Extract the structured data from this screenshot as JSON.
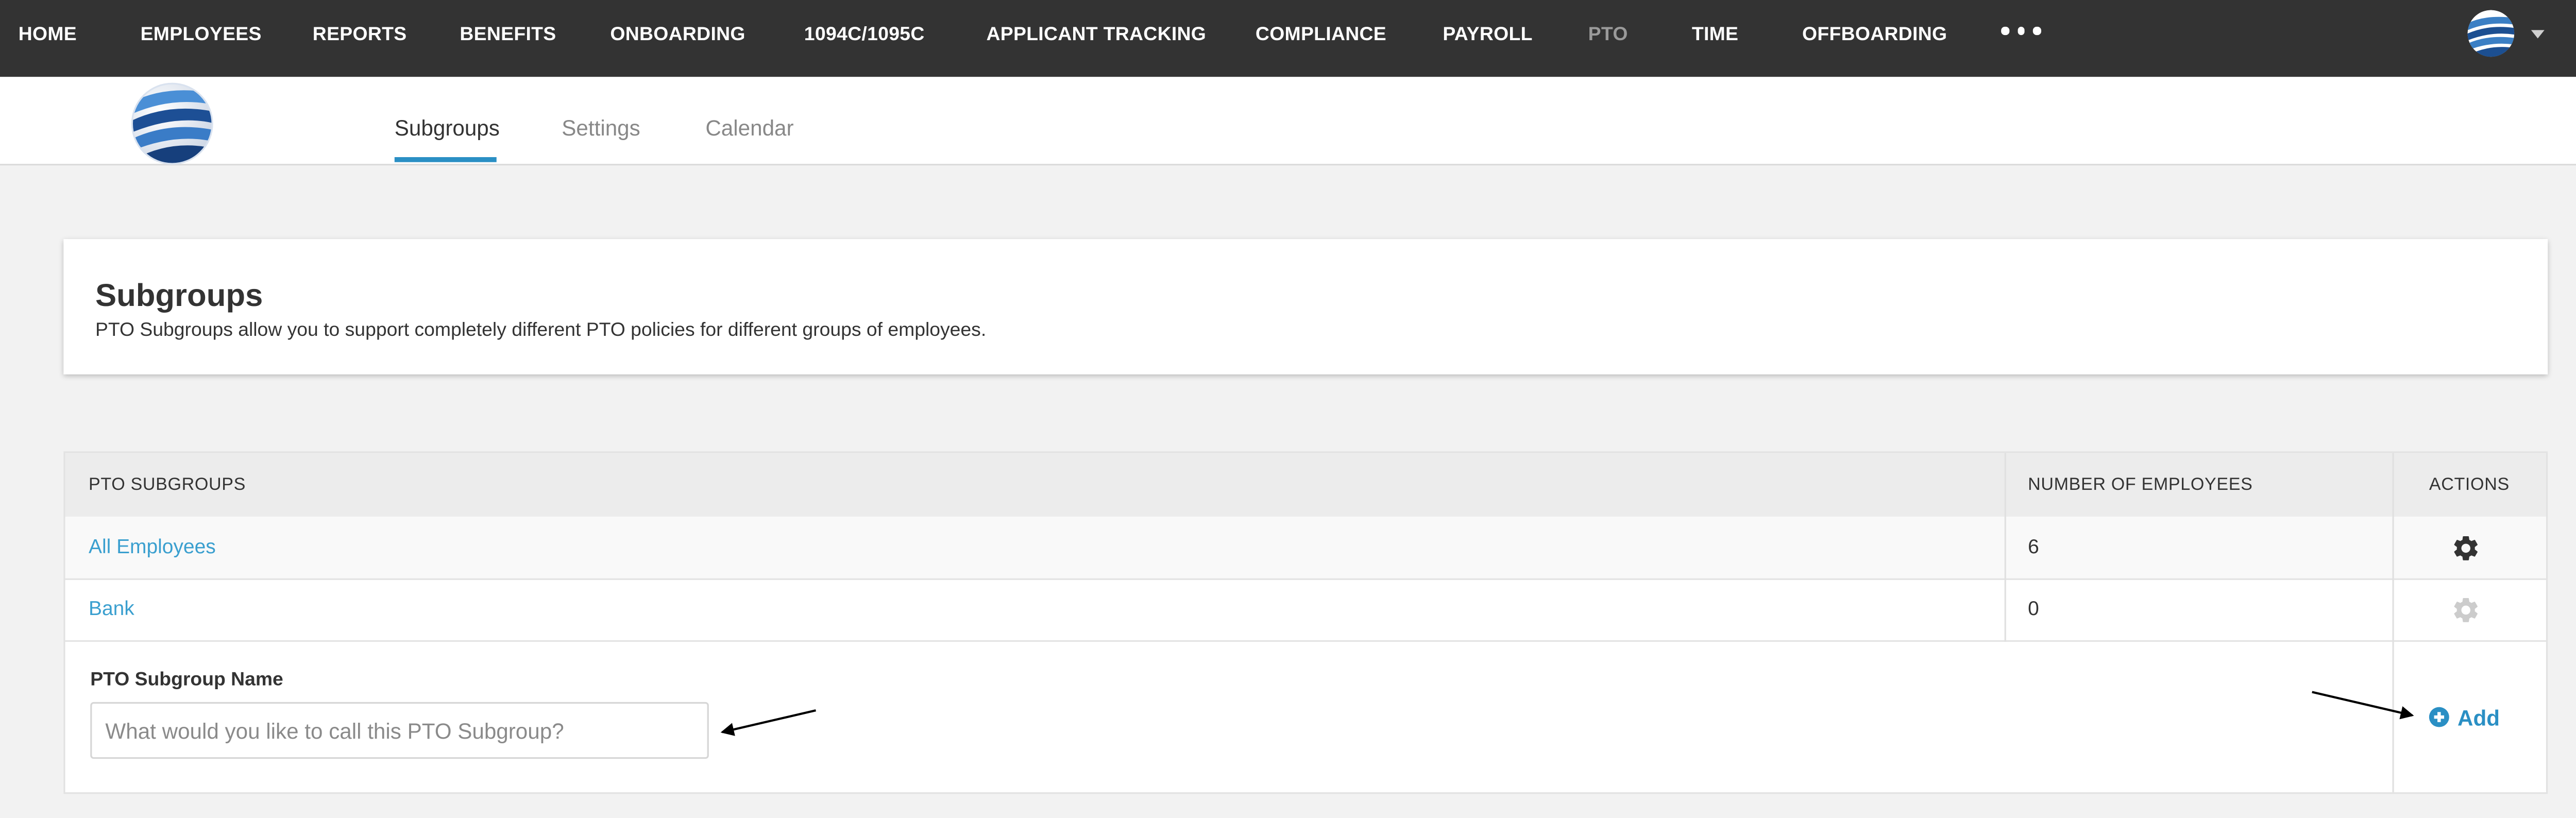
{
  "nav": {
    "items": [
      "HOME",
      "EMPLOYEES",
      "REPORTS",
      "BENEFITS",
      "ONBOARDING",
      "1094C/1095C",
      "APPLICANT TRACKING",
      "COMPLIANCE",
      "PAYROLL",
      "PTO",
      "TIME",
      "OFFBOARDING"
    ],
    "active": "PTO"
  },
  "tabs": [
    "Subgroups",
    "Settings",
    "Calendar"
  ],
  "card": {
    "title": "Subgroups",
    "description": "PTO Subgroups allow you to support completely different PTO policies for different groups of employees."
  },
  "table": {
    "headers": [
      "PTO SUBGROUPS",
      "NUMBER OF EMPLOYEES",
      "ACTIONS"
    ],
    "rows": [
      {
        "name": "All Employees",
        "count": "6"
      },
      {
        "name": "Bank",
        "count": "0"
      }
    ]
  },
  "form": {
    "label": "PTO Subgroup Name",
    "placeholder": "What would you like to call this PTO Subgroup?",
    "value": "",
    "add_label": "Add"
  },
  "colors": {
    "nav_bg": "#333333",
    "accent": "#2a8fc4",
    "link": "#3a9fcf",
    "gear_active": "#333333",
    "gear_disabled": "#cccccc"
  },
  "icons": [
    "globe-logo-icon",
    "more-icon",
    "avatar-globe-icon",
    "chevron-down-icon",
    "trash-icon",
    "gear-icon",
    "plus-circle-icon",
    "arrow-annotation"
  ]
}
